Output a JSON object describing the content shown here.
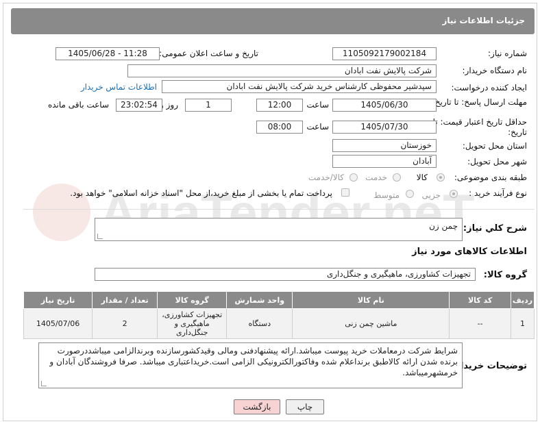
{
  "header": {
    "title": "جزئیات اطلاعات نیاز"
  },
  "fields": {
    "need_number_label": "شماره نیاز:",
    "need_number": "1105092179002184",
    "announce_label": "تاریخ و ساعت اعلان عمومی:",
    "announce_value": "1405/06/28 - 11:28",
    "buyer_label": "نام دستگاه خریدار:",
    "buyer_value": "شرکت پالایش نفت ابادان",
    "creator_label": "ایجاد کننده درخواست:",
    "creator_value": "سپدشیر محفوظی کارشناس خرید  شرکت پالایش نفت ابادان",
    "contact_link": "اطلاعات تماس خریدار",
    "deadline_label": "مهلت ارسال پاسخ: تا تاریخ:",
    "deadline_date": "1405/06/30",
    "time_label": "ساعت",
    "deadline_time": "12:00",
    "days_value": "1",
    "days_label": "روز و",
    "remaining_time": "23:02:54",
    "remaining_label": "ساعت باقی مانده",
    "price_validity_label": "حداقل تاریخ اعتبار قیمت: تا تاریخ:",
    "price_date": "1405/07/30",
    "price_time": "08:00",
    "province_label": "استان محل تحویل:",
    "province_value": "خوزستان",
    "city_label": "شهر محل تحویل:",
    "city_value": "آبادان",
    "category_label": "طبقه بندی موضوعی:",
    "category_options": [
      "کالا",
      "خدمت",
      "کالا/خدمت"
    ],
    "process_label": "نوع فرآیند خرید :",
    "process_options": [
      "جزیی",
      "متوسط"
    ],
    "payment_note": "پرداخت تمام یا بخشی از مبلغ خرید،از محل \"اسناد خزانه اسلامی\" خواهد بود."
  },
  "description": {
    "label": "شرح کلي نياز:",
    "value": "چمن زن"
  },
  "goods_section": {
    "title": "اطلاعات کالاهای مورد نیاز",
    "group_label": "گروه کالا:",
    "group_value": "تجهیزات کشاورزی، ماهیگیری و جنگل‌داری"
  },
  "table": {
    "headers": [
      "ردیف",
      "کد کالا",
      "نام کالا",
      "واحد شمارش",
      "گروه کالا",
      "تعداد / مقدار",
      "تاریخ نیاز"
    ],
    "rows": [
      [
        "1",
        "--",
        "ماشین چمن زنی",
        "دستگاه",
        "تجهیزات کشاورزی، ماهیگیری و جنگل‌داری",
        "2",
        "1405/07/06"
      ]
    ]
  },
  "buyer_notes": {
    "label": "توضیحات خریدار:",
    "value": "شرایط شرکت درمعاملات خرید پیوست میباشد.ارائه پیشنهادفنی ومالی وقیدکشورسازنده وبرندالزامی میباشددرصورت برنده شدن ارائه کالاطبق برنداعلام شده وفاکتورالکترونیکی الزامی است.خریداعتباری میباشد. صرفا فروشندگان آبادان و خرمشهرمیباشد."
  },
  "buttons": {
    "print": "چاپ",
    "back": "بازگشت"
  },
  "watermark_text": "AriaTender.neT",
  "colors": {
    "header": "#8a8a8a",
    "link": "#1a6fb5",
    "back_button": "#f8d3d3"
  }
}
